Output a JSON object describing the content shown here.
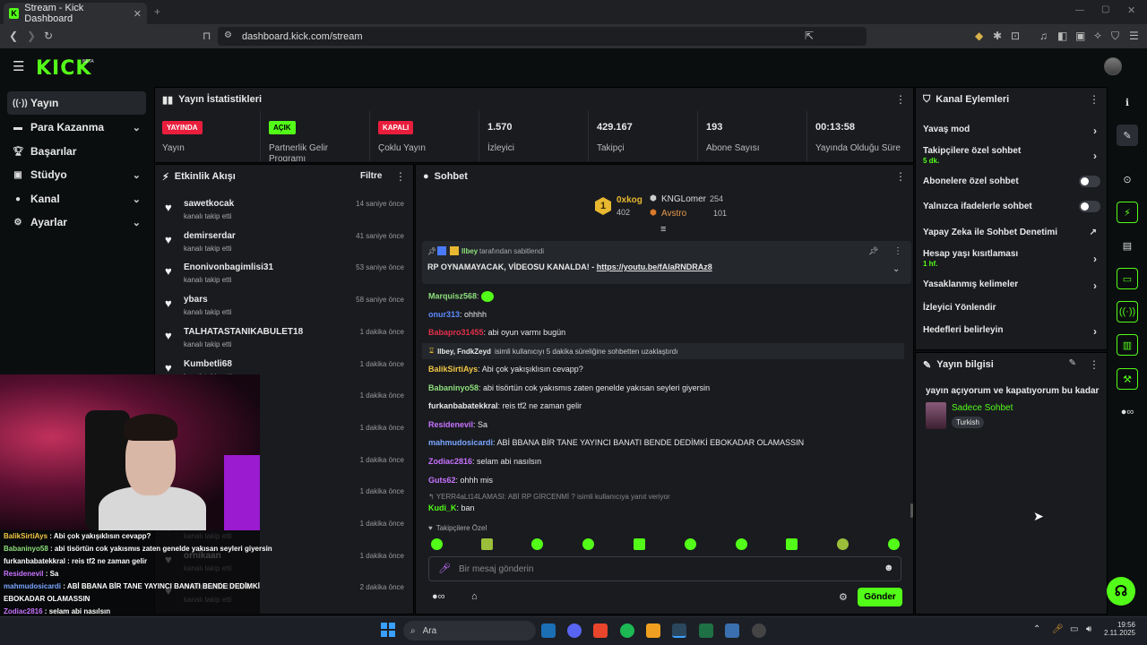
{
  "browser": {
    "tab_title": "Stream - Kick Dashboard",
    "url": "dashboard.kick.com/stream"
  },
  "header": {
    "logo": "KICK",
    "logo_badge": "BETA"
  },
  "sidebar": {
    "items": [
      {
        "label": "Yayın"
      },
      {
        "label": "Para Kazanma"
      },
      {
        "label": "Başarılar"
      },
      {
        "label": "Stüdyo"
      },
      {
        "label": "Kanal"
      },
      {
        "label": "Ayarlar"
      }
    ]
  },
  "stats": {
    "title": "Yayın İstatistikleri",
    "items": [
      {
        "badge": "YAYINDA",
        "label": "Yayın"
      },
      {
        "badge": "AÇIK",
        "label": "Partnerlik Gelir Programı"
      },
      {
        "badge": "KAPALI",
        "label": "Çoklu Yayın"
      },
      {
        "value": "1.570",
        "label": "İzleyici"
      },
      {
        "value": "429.167",
        "label": "Takipçi"
      },
      {
        "value": "193",
        "label": "Abone Sayısı"
      },
      {
        "value": "00:13:58",
        "label": "Yayında Olduğu Süre"
      }
    ]
  },
  "events": {
    "title": "Etkinlik Akışı",
    "filter": "Filtre",
    "items": [
      {
        "name": "sawetkocak",
        "action": "kanalı takip etti",
        "time": "14 saniye önce"
      },
      {
        "name": "demirserdar",
        "action": "kanalı takip etti",
        "time": "41 saniye önce"
      },
      {
        "name": "Enonivonbagimlisi31",
        "action": "kanalı takip etti",
        "time": "53 saniye önce"
      },
      {
        "name": "ybars",
        "action": "kanalı takip etti",
        "time": "58 saniye önce"
      },
      {
        "name": "TALHATASTANIKABULET18",
        "action": "kanalı takip etti",
        "time": "1 dakika önce"
      },
      {
        "name": "Kumbetli68",
        "action": "kanalı takip etti",
        "time": "1 dakika önce"
      },
      {
        "name": "",
        "action": "",
        "time": "1 dakika önce"
      },
      {
        "name": "",
        "action": "",
        "time": "1 dakika önce"
      },
      {
        "name": "",
        "action": "",
        "time": "1 dakika önce"
      },
      {
        "name": "",
        "action": "",
        "time": "1 dakika önce"
      },
      {
        "name": "",
        "action": "kanalı takip etti",
        "time": "1 dakika önce"
      },
      {
        "name": "ornikaan",
        "action": "kanalı takip etti",
        "time": "1 dakika önce"
      },
      {
        "name": "mehmetfatihtek",
        "action": "kanalı takip etti",
        "time": "2 dakika önce"
      }
    ]
  },
  "chat": {
    "title": "Sohbet",
    "leaderboard": {
      "first_name": "0xkog",
      "first_count": "402",
      "rank": "1",
      "second_name": "KNGLomer",
      "second_count": "254",
      "third_name": "Avstro",
      "third_count": "101"
    },
    "pinned": {
      "by": "Ilbey",
      "by_suffix": "tarafından sabitlendi",
      "text": "RP OYNAMAYACAK, VİDEOSU KANALDA! - ",
      "link": "https://youtu.be/fAlaRNDRAz8"
    },
    "messages": [
      {
        "user": "Marquisz568",
        "color": "#8ee07c",
        "text": ""
      },
      {
        "user": "onur313",
        "color": "#5d8bff",
        "text": "ohhhh"
      },
      {
        "user": "Babapro31455",
        "color": "#e0304a",
        "text": "abi oyun varmı bugün"
      },
      {
        "user": "BalikSirtiAys",
        "color": "#f2c744",
        "text": "Abi çok yakışıklısın cevapp?"
      },
      {
        "user": "Babaninyo58",
        "color": "#8ee07c",
        "text": "abi tisörtün cok yakısmıs zaten genelde yakısan seyleri giyersin"
      },
      {
        "user": "furkanbabatekkral",
        "color": "#e8e8e8",
        "text": "reis tf2 ne zaman gelir"
      },
      {
        "user": "Residenevil",
        "color": "#c873ff",
        "text": "Sa"
      },
      {
        "user": "mahmudosicardi",
        "color": "#7aa6ff",
        "text": "ABİ BBANA BİR TANE YAYINCI BANATI BENDE DEDİMKİ EBOKADAR OLAMASSIN"
      },
      {
        "user": "Zodiac2816",
        "color": "#c873ff",
        "text": "selam abi nasılsın"
      },
      {
        "user": "Guts62",
        "color": "#c873ff",
        "text": "ohhh mis"
      },
      {
        "user": "Kudi_K",
        "color": "#53fc18",
        "text": "ban"
      }
    ],
    "timeout_notice": {
      "users": "Ilbey, FndkZeyd",
      "text": "isimli kullanıcıyı 5 dakika süreliğine sohbetten uzaklaştırdı"
    },
    "reply_notice": "YERR4aLt14LAMASI: ABİ RP GİRCENMİ ? isimli kullanıcıya yanıt veriyor",
    "followers_only": "Takipçilere Özel",
    "input_placeholder": "Bir mesaj gönderin",
    "send": "Gönder"
  },
  "channel_actions": {
    "title": "Kanal Eylemleri",
    "items": [
      {
        "label": "Yavaş mod",
        "sub": ""
      },
      {
        "label": "Takipçilere özel sohbet",
        "sub": "5 dk."
      },
      {
        "label": "Abonelere özel sohbet",
        "sub": ""
      },
      {
        "label": "Yalnızca ifadelerle sohbet",
        "sub": ""
      },
      {
        "label": "Yapay Zeka ile Sohbet Denetimi",
        "sub": ""
      },
      {
        "label": "Hesap yaşı kısıtlaması",
        "sub": "1 hf."
      },
      {
        "label": "Yasaklanmış kelimeler",
        "sub": ""
      },
      {
        "label": "İzleyici Yönlendir",
        "sub": ""
      },
      {
        "label": "Hedefleri belirleyin",
        "sub": ""
      }
    ]
  },
  "stream_info": {
    "title": "Yayın bilgisi",
    "stream_title": "yayın açıyorum ve kapatıyorum bu kadar",
    "category": "Sadece Sohbet",
    "language": "Turkish"
  },
  "overlay_chat": [
    {
      "user": "BalikSirtiAys",
      "text": "Abi çok yakışıklısın cevapp?",
      "color": "#f2c744"
    },
    {
      "user": "Babaninyo58",
      "text": "abi tisörtün cok yakısmıs zaten genelde yakısan seyleri giyersin",
      "color": "#8ee07c"
    },
    {
      "user": "furkanbabatekkral",
      "text": "reis tf2 ne zaman gelir",
      "color": "#ffffff"
    },
    {
      "user": "Residenevil",
      "text": "Sa",
      "color": "#c873ff"
    },
    {
      "user": "mahmudosicardi",
      "text": "ABİ BBANA BİR TANE YAYINCI BANATI BENDE DEDİMKİ",
      "color": "#7aa6ff"
    },
    {
      "user": "",
      "text": "EBOKADAR OLAMASSIN",
      "color": "#ffffff"
    },
    {
      "user": "Zodiac2816",
      "text": "selam abi nasılsın",
      "color": "#c873ff"
    },
    {
      "user": "Guts62",
      "text": "ohhh mis",
      "color": "#c873ff"
    },
    {
      "user": "",
      "text": "ben",
      "color": "#ffffff"
    }
  ],
  "taskbar": {
    "search": "Ara",
    "time": "19:56",
    "date": "2.11.2025"
  }
}
